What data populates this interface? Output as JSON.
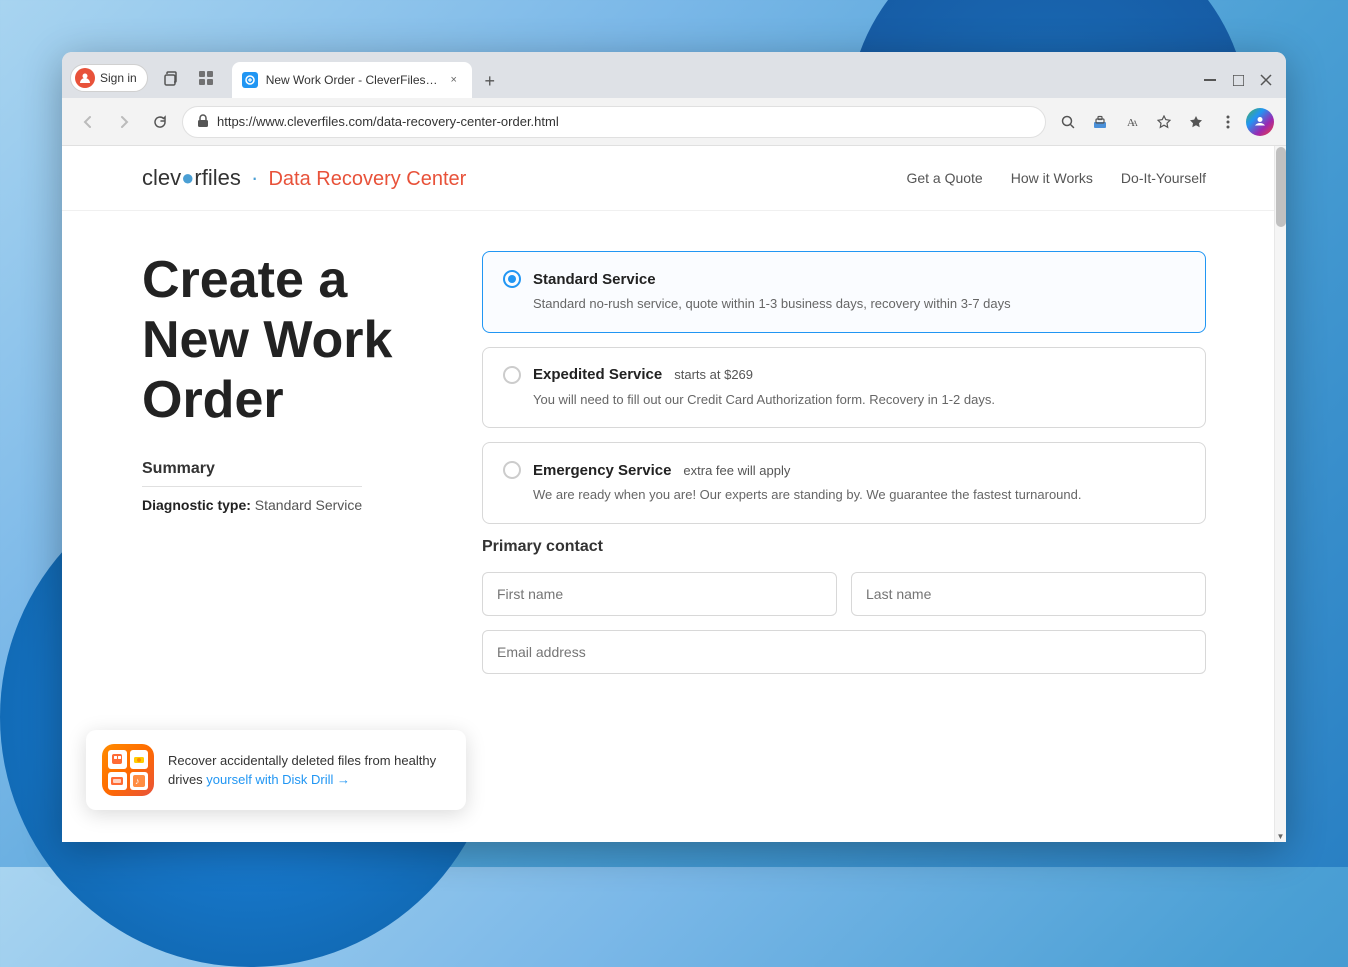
{
  "browser": {
    "sign_in_label": "Sign in",
    "tab_title": "New Work Order - CleverFiles Da",
    "url_domain": "https://www.cleverfiles.com",
    "url_path": "/data-recovery-center-order.html",
    "url_display": "https://www.cleverfiles.com/data-recovery-center-order.html"
  },
  "site": {
    "logo_text": "cleverfiles",
    "logo_separator": "·",
    "logo_drc": "Data Recovery Center",
    "nav_links": [
      {
        "label": "Get a Quote"
      },
      {
        "label": "How it Works"
      },
      {
        "label": "Do-It-Yourself"
      }
    ]
  },
  "page": {
    "title": "Create a New Work Order",
    "summary_title": "Summary",
    "diagnostic_label": "Diagnostic type:",
    "diagnostic_value": "Standard Service"
  },
  "services": [
    {
      "id": "standard",
      "name": "Standard Service",
      "badge": "",
      "desc": "Standard no-rush service, quote within 1-3 business days, recovery within 3-7 days",
      "selected": true
    },
    {
      "id": "expedited",
      "name": "Expedited Service",
      "badge": "starts at $269",
      "desc": "You will need to fill out our Credit Card Authorization form. Recovery in 1-2 days.",
      "selected": false
    },
    {
      "id": "emergency",
      "name": "Emergency Service",
      "badge": "extra fee will apply",
      "desc": "We are ready when you are! Our experts are standing by. We guarantee the fastest turnaround.",
      "selected": false
    }
  ],
  "form": {
    "primary_contact_label": "Primary contact",
    "first_name_placeholder": "First name",
    "last_name_placeholder": "Last name",
    "email_placeholder": "Email address"
  },
  "toast": {
    "text_before": "Recover accidentally deleted files from healthy drives ",
    "link_text": "yourself with Disk Drill →",
    "link_url": "#"
  }
}
